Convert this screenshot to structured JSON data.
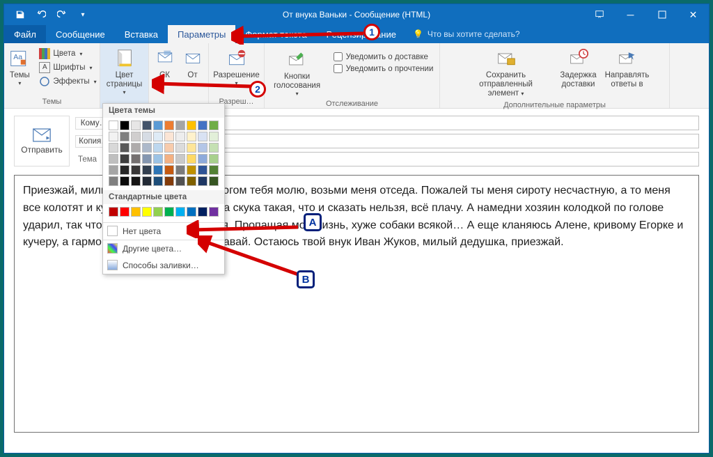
{
  "titlebar": {
    "title": "От внука Ваньки - Сообщение (HTML)"
  },
  "menubar": {
    "file": "Файл",
    "tabs": [
      "Сообщение",
      "Вставка",
      "Параметры",
      "Формат текста",
      "Рецензирование"
    ],
    "active_index": 2,
    "tell_me": "Что вы хотите сделать?"
  },
  "ribbon": {
    "themes": {
      "label": "Темы",
      "main": "Темы",
      "colors": "Цвета",
      "fonts": "Шрифты",
      "effects": "Эффекты"
    },
    "page_color": {
      "label": "Цвет страницы"
    },
    "bcc": {
      "label": "СК"
    },
    "from": {
      "label": "От"
    },
    "permission": {
      "label": "Разрешение",
      "group": "Разреш…"
    },
    "voting": {
      "label": "Кнопки голосования"
    },
    "delivery_receipt": "Уведомить о доставке",
    "read_receipt": "Уведомить о прочтении",
    "tracking_group": "Отслеживание",
    "save_sent": {
      "line1": "Сохранить отправленный",
      "line2": "элемент"
    },
    "delay": {
      "line1": "Задержка",
      "line2": "доставки"
    },
    "direct_replies": {
      "line1": "Направлять",
      "line2": "ответы в"
    },
    "more_group": "Дополнительные параметры"
  },
  "compose": {
    "send": "Отправить",
    "to": "Кому…",
    "cc": "Копия…",
    "subject": "Тема"
  },
  "color_popup": {
    "theme_colors": "Цвета темы",
    "standard_colors": "Стандартные цвета",
    "no_color": "Нет цвета",
    "more_colors": "Другие цвета…",
    "fill_effects": "Способы заливки…"
  },
  "body_text": "Приезжай, милый дедушка, Христом богом тебя молю, возьми меня отседа. Пожалей ты меня сироту несчастную, а то меня все колотят и кушать страсть хочется, а скука такая, что и сказать нельзя, всё плачу. А намедни хозяин колодкой по голове ударил, так что упал и насилу очухался. Пропащая моя жизнь, хуже собаки всякой… А еще кланяюсь Алене, кривому Егорке и кучеру, а гармонию мою никому не отдавай. Остаюсь твой внук Иван Жуков, милый дедушка, приезжай.",
  "annotations": {
    "n1": "1",
    "n2": "2",
    "a": "A",
    "b": "B"
  },
  "colors": {
    "theme_row_top": [
      "#ffffff",
      "#000000",
      "#e7e6e6",
      "#44546a",
      "#5b9bd5",
      "#ed7d31",
      "#a5a5a5",
      "#ffc000",
      "#4472c4",
      "#70ad47"
    ],
    "theme_shades": [
      [
        "#f2f2f2",
        "#7f7f7f",
        "#d0cece",
        "#d6dce4",
        "#deebf6",
        "#fbe5d5",
        "#ededed",
        "#fff2cc",
        "#d9e2f3",
        "#e2efd9"
      ],
      [
        "#d8d8d8",
        "#595959",
        "#aeabab",
        "#adb9ca",
        "#bdd7ee",
        "#f7cbac",
        "#dbdbdb",
        "#fee599",
        "#b4c6e7",
        "#c5e0b3"
      ],
      [
        "#bfbfbf",
        "#3f3f3f",
        "#757070",
        "#8496b0",
        "#9cc3e5",
        "#f4b183",
        "#c9c9c9",
        "#ffd965",
        "#8eaadb",
        "#a8d08d"
      ],
      [
        "#a5a5a5",
        "#262626",
        "#3a3838",
        "#323f4f",
        "#2e75b5",
        "#c55a11",
        "#7b7b7b",
        "#bf9000",
        "#2f5496",
        "#538135"
      ],
      [
        "#7f7f7f",
        "#0c0c0c",
        "#171616",
        "#222a35",
        "#1e4e79",
        "#833c0b",
        "#525252",
        "#7f6000",
        "#1f3864",
        "#375623"
      ]
    ],
    "standard": [
      "#c00000",
      "#ff0000",
      "#ffc000",
      "#ffff00",
      "#92d050",
      "#00b050",
      "#00b0f0",
      "#0070c0",
      "#002060",
      "#7030a0"
    ]
  }
}
